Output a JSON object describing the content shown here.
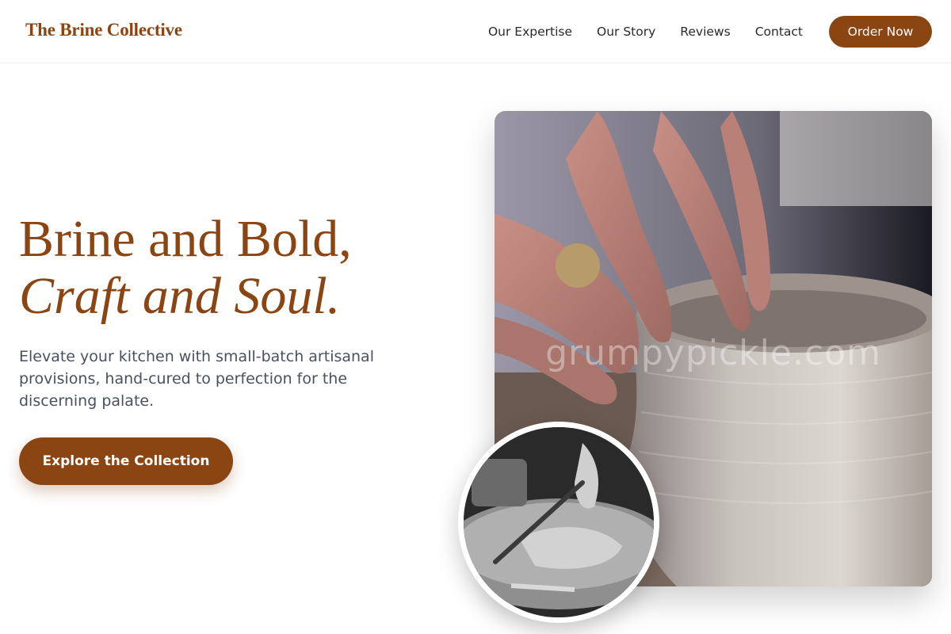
{
  "header": {
    "brand": "The Brine Collective",
    "nav": [
      "Our Expertise",
      "Our Story",
      "Reviews",
      "Contact"
    ],
    "order_label": "Order Now"
  },
  "hero": {
    "title_line1": "Brine and Bold,",
    "title_line2": "Craft and Soul.",
    "subtitle": "Elevate your kitchen with small-batch artisanal provisions, hand-cured to perfection for the discerning palate.",
    "cta_label": "Explore the Collection"
  },
  "media": {
    "main_watermark": "grumpypickle.com",
    "main_subject": "potter shaping a clay vessel on a wheel",
    "circle_subject": "woodworker carving with a chisel (black and white)"
  },
  "colors": {
    "brand": "#8b4513",
    "text": "#2a2a2a",
    "muted": "#4a5060"
  }
}
